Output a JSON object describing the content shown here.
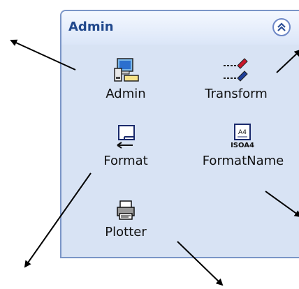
{
  "panel": {
    "title": "Admin",
    "collapse_icon": "double-chevron-up-icon",
    "commands": [
      {
        "label": "Admin",
        "icon": "admin-computer-icon"
      },
      {
        "label": "Transform",
        "icon": "pen-transform-icon"
      },
      {
        "label": "Format",
        "icon": "format-sheet-icon"
      },
      {
        "label": "FormatName",
        "icon": "iso-a4-icon"
      },
      {
        "label": "Plotter",
        "icon": "printer-icon"
      }
    ]
  },
  "colors": {
    "panel_border": "#7a95c7",
    "panel_background": "#d8e3f4",
    "title_text": "#21488c",
    "arrows": "#000000"
  },
  "annotations": {
    "arrow_count": 5
  }
}
